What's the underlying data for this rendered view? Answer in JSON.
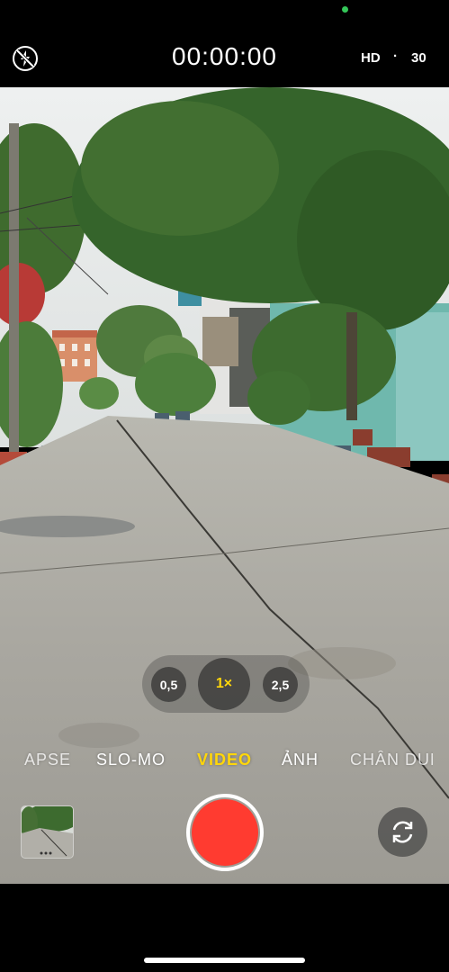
{
  "status": {
    "privacy_indicator_color": "#34c759"
  },
  "top_bar": {
    "flash_icon": "flash-off-icon",
    "timer": "00:00:00",
    "resolution": "HD",
    "separator": "·",
    "fps": "30"
  },
  "zoom": {
    "options": [
      "0,5",
      "1×",
      "2,5"
    ],
    "selected": "1×"
  },
  "modes": {
    "items": [
      "LAPSE",
      "SLO-MO",
      "VIDEO",
      "ẢNH",
      "CHÂN DUNG"
    ],
    "selected": "VIDEO"
  },
  "controls": {
    "last_media_thumbnail": "photo-thumbnail",
    "shutter_icon": "record-button",
    "flip_icon": "camera-flip-icon"
  },
  "colors": {
    "accent": "#ffd60a",
    "record": "#ff3b30",
    "background": "#000000"
  }
}
